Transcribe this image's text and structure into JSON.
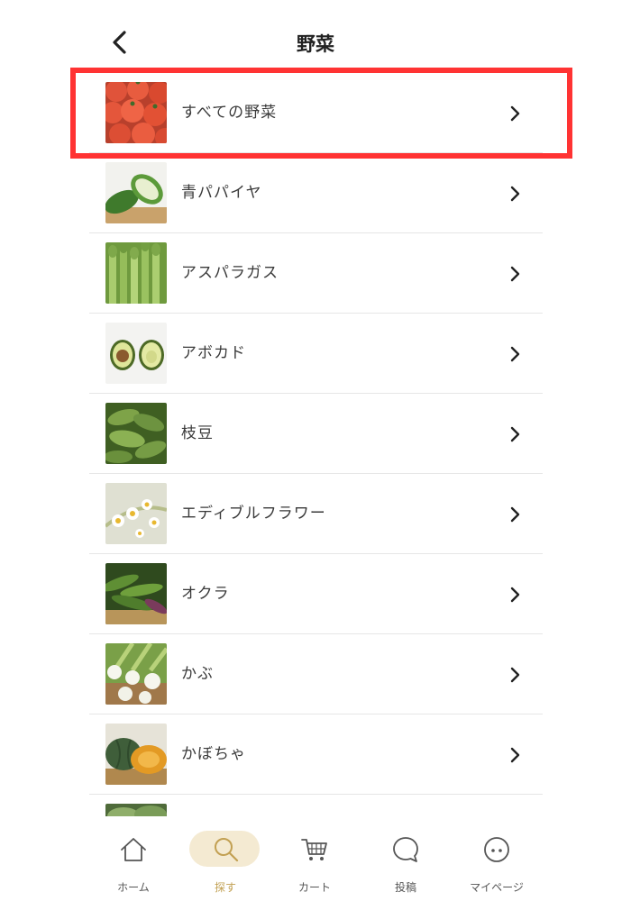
{
  "header": {
    "title": "野菜",
    "back_icon": "chevron-left-icon"
  },
  "list": {
    "items": [
      {
        "label": "すべての野菜",
        "image": "tomatoes"
      },
      {
        "label": "青パパイヤ",
        "image": "green-papaya"
      },
      {
        "label": "アスパラガス",
        "image": "asparagus"
      },
      {
        "label": "アボカド",
        "image": "avocado"
      },
      {
        "label": "枝豆",
        "image": "edamame"
      },
      {
        "label": "エディブルフラワー",
        "image": "edible-flowers"
      },
      {
        "label": "オクラ",
        "image": "okra"
      },
      {
        "label": "かぶ",
        "image": "turnip"
      },
      {
        "label": "かぼちゃ",
        "image": "pumpkin"
      },
      {
        "label": "",
        "image": "partial-next-item"
      }
    ],
    "highlight_color": "#ff3333"
  },
  "tabbar": {
    "tabs": [
      {
        "label": "ホーム",
        "icon": "home-icon",
        "active": false
      },
      {
        "label": "探す",
        "icon": "search-icon",
        "active": true
      },
      {
        "label": "カート",
        "icon": "cart-icon",
        "active": false
      },
      {
        "label": "投稿",
        "icon": "speech-bubble-icon",
        "active": false
      },
      {
        "label": "マイページ",
        "icon": "more-dots-icon",
        "active": false
      }
    ],
    "active_color": "#c2a052",
    "active_pill_color": "#f4ead2"
  }
}
